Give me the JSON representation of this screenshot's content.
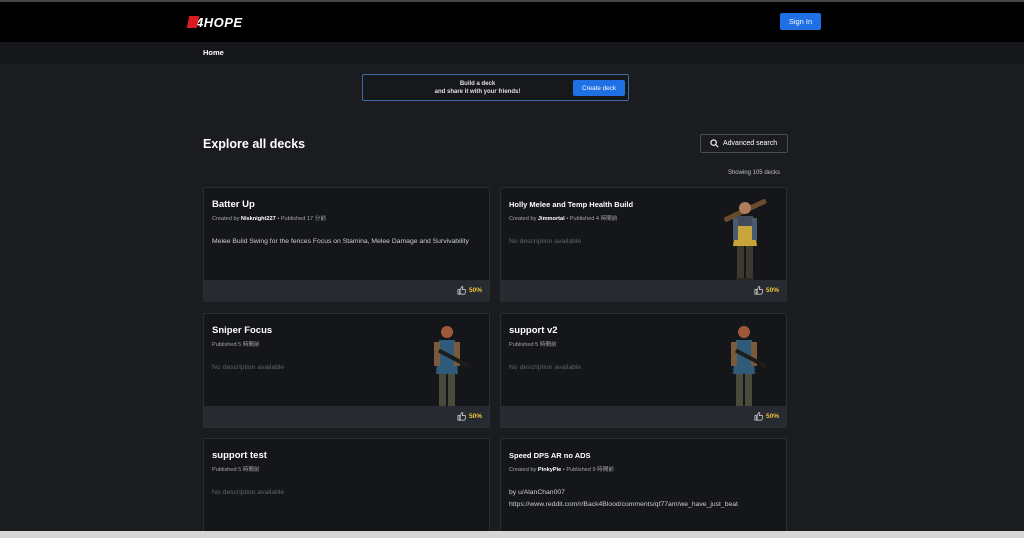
{
  "header": {
    "logo_text": "4HOPE",
    "signin_label": "Sign In",
    "accent": "#1f6fe5"
  },
  "subnav": {
    "home_label": "Home"
  },
  "banner": {
    "line1": "Build a deck",
    "line2": "and share it with your friends!",
    "button_label": "Create deck"
  },
  "main": {
    "title": "Explore all decks",
    "advanced_search_label": "Advanced search",
    "showing_text": "Showing 105 decks"
  },
  "decks": [
    {
      "title": "Batter Up",
      "created_prefix": "Created by ",
      "author": "Nisknight227",
      "published": "Published 17 分前",
      "description": "Melee Build Swing for the fences Focus on Stamina, Melee Damage and Survivability",
      "rating": "50%",
      "portrait": ""
    },
    {
      "title": "Holly Melee and Temp Health Build",
      "created_prefix": "Created by ",
      "author": "Jimmortal",
      "published": "Published 4 時間前",
      "description": "No description available",
      "rating": "50%",
      "portrait": "melee-character"
    },
    {
      "title": "Sniper Focus",
      "created_prefix": "",
      "author": "",
      "published": "Published 5 時間前",
      "description": "No description available",
      "rating": "50%",
      "portrait": "rifle-character"
    },
    {
      "title": "support v2",
      "created_prefix": "",
      "author": "",
      "published": "Published 5 時間前",
      "description": "No description available",
      "rating": "50%",
      "portrait": "rifle-character"
    },
    {
      "title": "support test",
      "created_prefix": "",
      "author": "",
      "published": "Published 5 時間前",
      "description": "No description available"
    },
    {
      "title": "Speed DPS AR no ADS",
      "created_prefix": "Created by ",
      "author": "PinkyPie",
      "published": "Published 9 時間前",
      "description_line1": "by u/AlanChan007",
      "description_line2": "https://www.reddit.com/r/Back4Blood/comments/qf77am/we_have_just_beat"
    }
  ]
}
